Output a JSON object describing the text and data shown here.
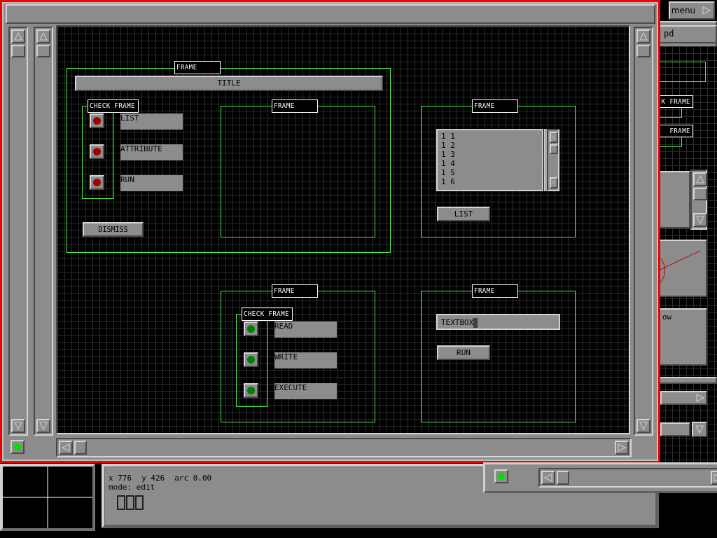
{
  "menu_button": {
    "label": "menu"
  },
  "back_window": {
    "title": "pd",
    "labels": [
      "K FRAME",
      "FRAME"
    ],
    "panel_text": "ow"
  },
  "canvas": {
    "title_bar": {
      "label": "TITLE"
    },
    "frames": [
      {
        "label": "FRAME"
      },
      {
        "label": "FRAME"
      },
      {
        "label": "FRAME"
      },
      {
        "label": "FRAME"
      },
      {
        "label": "FRAME"
      }
    ],
    "check_frames": [
      {
        "label": "CHECK FRAME",
        "items": [
          {
            "label": "LIST",
            "color": "#a00000"
          },
          {
            "label": "ATTRIBUTE",
            "color": "#a00000"
          },
          {
            "label": "RUN",
            "color": "#a00000"
          }
        ]
      },
      {
        "label": "CHECK FRAME",
        "items": [
          {
            "label": "READ",
            "color": "#008000"
          },
          {
            "label": "WRITE",
            "color": "#008000"
          },
          {
            "label": "EXECUTE",
            "color": "#008000"
          }
        ]
      }
    ],
    "dismiss_button": {
      "label": "DISMISS"
    },
    "listbox": {
      "items": [
        "1 1",
        "1 2",
        "1 3",
        "1 4",
        "1 5",
        "1 6"
      ]
    },
    "list_button": {
      "label": "LIST"
    },
    "textbox": {
      "value": "TEXTBOX"
    },
    "run_button": {
      "label": "RUN"
    }
  },
  "status_bar": {
    "x": "x 776",
    "y": "y 426",
    "arc": "arc 0.00",
    "mode": "mode: edit"
  }
}
